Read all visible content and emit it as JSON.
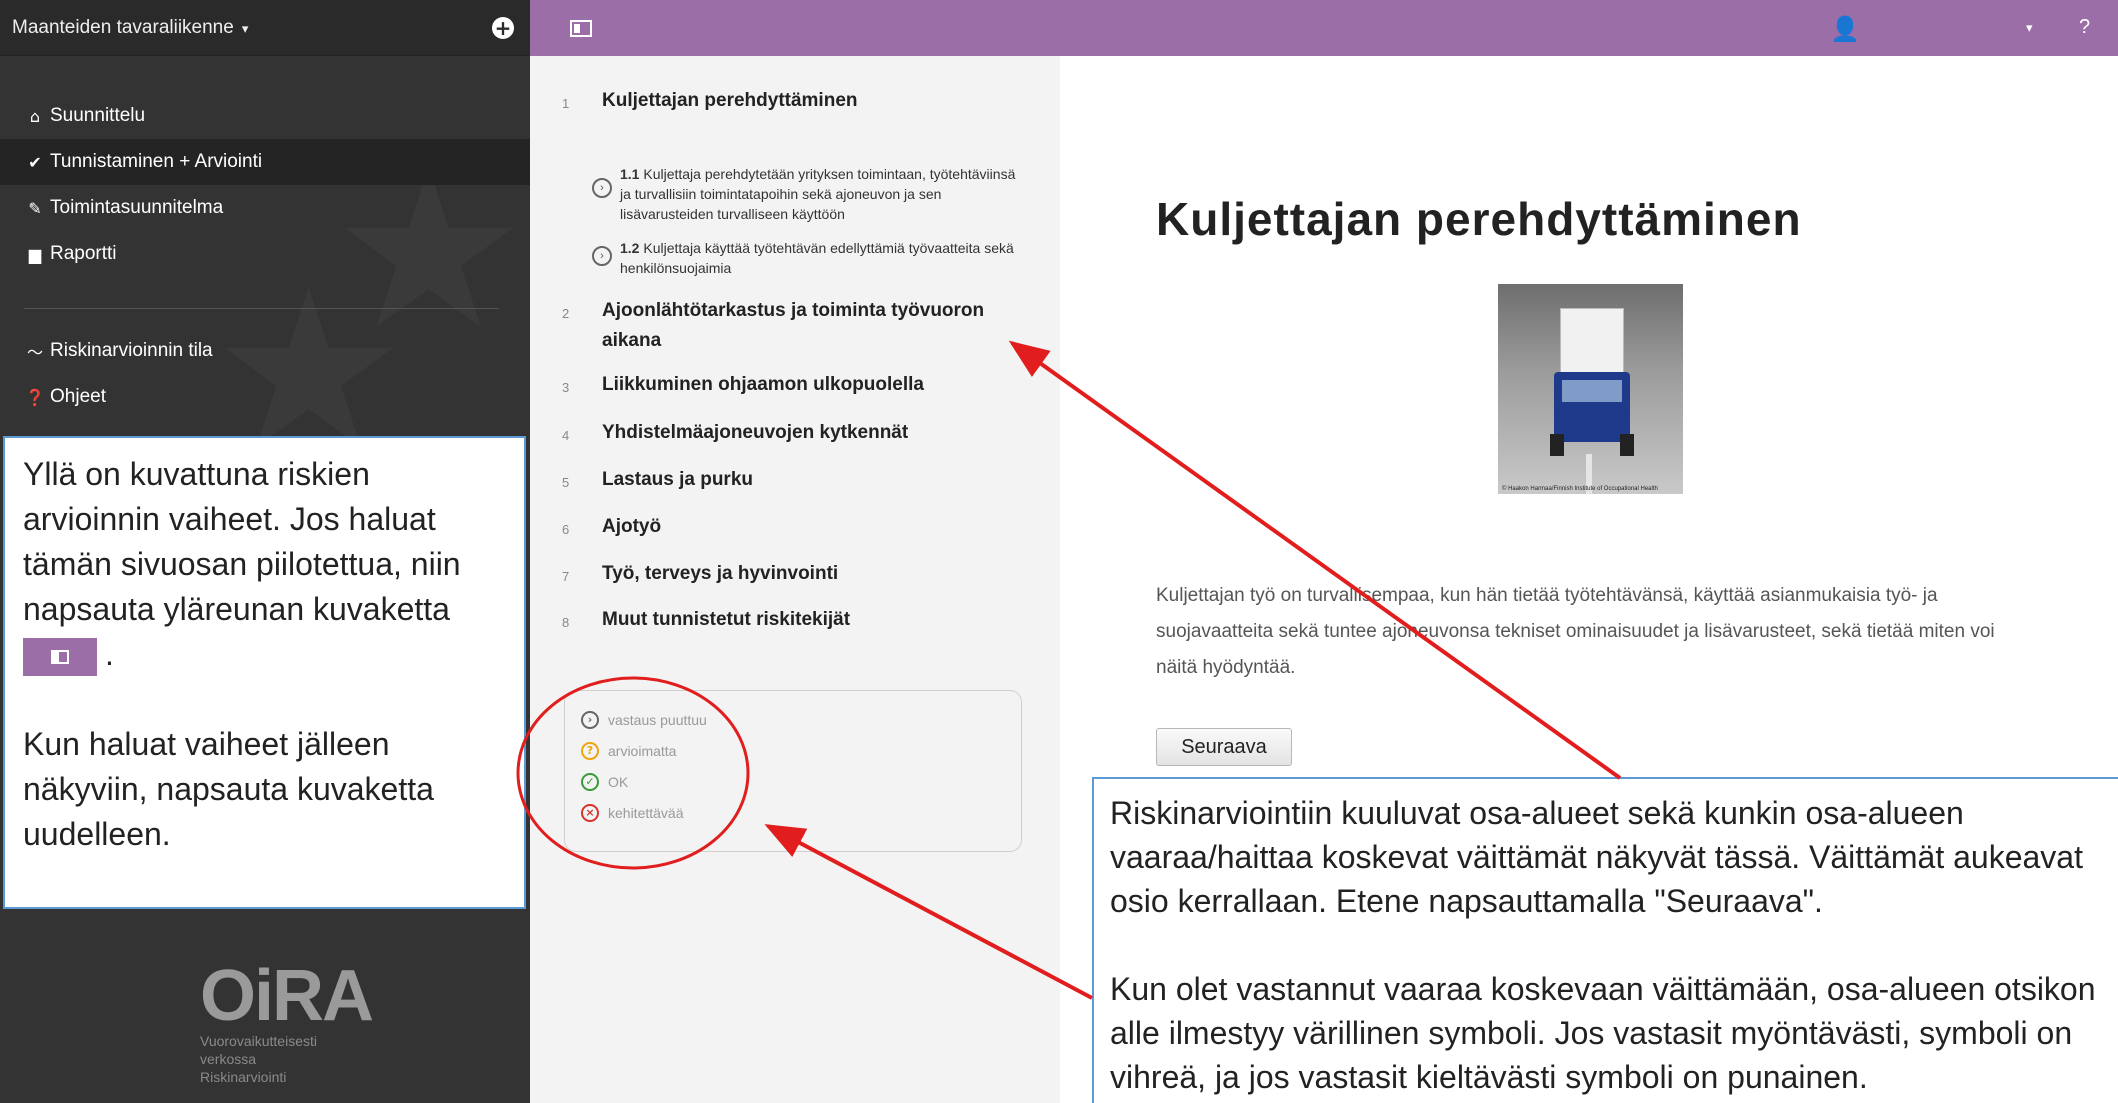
{
  "header": {
    "tool_name": "Maanteiden tavaraliikenne",
    "tool_caret": "▾",
    "user_caret": "▾",
    "help_label": "?"
  },
  "sidebar": {
    "nav": [
      {
        "label": "Suunnittelu",
        "icon": "home-icon"
      },
      {
        "label": "Tunnistaminen + Arviointi",
        "icon": "check-circle-icon",
        "active": true
      },
      {
        "label": "Toimintasuunnitelma",
        "icon": "pencil-icon"
      },
      {
        "label": "Raportti",
        "icon": "document-icon"
      },
      {
        "label": "Riskinarvioinnin tila",
        "icon": "chart-icon"
      },
      {
        "label": "Ohjeet",
        "icon": "help-circle-icon"
      }
    ],
    "help_box": {
      "p1_before": "Yllä on kuvattuna riskien arvioinnin vaiheet. Jos haluat tämän sivuosan piilotettua, niin napsauta yläreunan kuvaketta",
      "p1_after": ".",
      "p2": "Kun haluat vaiheet jälleen näkyviin, napsauta kuvaketta uudelleen."
    },
    "logo": {
      "mark": "OiRA",
      "line1": "Vuorovaikutteisesti",
      "line2": "verkossa",
      "line3": "Riskinarviointi"
    }
  },
  "steps": {
    "modules": [
      {
        "num": "1",
        "title": "Kuljettajan perehdyttäminen"
      },
      {
        "num": "2",
        "title": "Ajoonlähtötarkastus ja toiminta työvuoron aikana"
      },
      {
        "num": "3",
        "title": "Liikkuminen ohjaamon ulkopuolella"
      },
      {
        "num": "4",
        "title": "Yhdistelmäajoneuvojen kytkennät"
      },
      {
        "num": "5",
        "title": "Lastaus ja purku"
      },
      {
        "num": "6",
        "title": "Ajotyö"
      },
      {
        "num": "7",
        "title": "Työ, terveys ja hyvinvointi"
      },
      {
        "num": "8",
        "title": "Muut tunnistetut riskitekijät"
      }
    ],
    "risks": [
      {
        "num": "1.1",
        "text": "Kuljettaja perehdytetään yrityksen toimintaan, työtehtäviinsä ja turvallisiin toimintatapoihin sekä ajoneuvon ja sen lisävarusteiden turvalliseen käyttöön"
      },
      {
        "num": "1.2",
        "text": "Kuljettaja käyttää työtehtävän edellyttämiä työvaatteita sekä henkilönsuojaimia"
      }
    ],
    "legend": [
      {
        "label": "vastaus puuttuu",
        "symbol": "›",
        "color": "#666666"
      },
      {
        "label": "arvioimatta",
        "symbol": "?",
        "color": "#f0a30a"
      },
      {
        "label": "OK",
        "symbol": "✓",
        "color": "#3a9a3a"
      },
      {
        "label": "kehitettävää",
        "symbol": "×",
        "color": "#d9342b"
      }
    ]
  },
  "content": {
    "title": "Kuljettajan perehdyttäminen",
    "image_credit": "© Haakon Harmaa/Finnish Institute of Occupational Health",
    "intro": "Kuljettajan työ on turvallisempaa, kun hän tietää työtehtävänsä, käyttää asianmukaisia työ- ja suojavaatteita sekä tuntee ajoneuvonsa tekniset ominaisuudet ja lisävarusteet, sekä tietää miten voi näitä hyödyntää.",
    "next_label": "Seuraava"
  },
  "info_box": {
    "p1": "Riskinarviointiin kuuluvat osa-alueet sekä kunkin osa-alueen vaaraa/haittaa koskevat väittämät näkyvät tässä. Väittämät aukeavat osio kerrallaan. Etene napsauttamalla \"Seuraava\".",
    "p2": "Kun olet vastannut vaaraa koskevaan väittämään, osa-alueen otsikon alle ilmestyy värillinen symboli. Jos vastasit myöntävästi, symboli on vihreä, ja jos vastasit kieltävästi symboli on punainen."
  },
  "colors": {
    "accent": "#9b6ea8",
    "sidebar": "#333333",
    "annotation": "#e11d1d",
    "callout_border": "#5b9bd5"
  }
}
